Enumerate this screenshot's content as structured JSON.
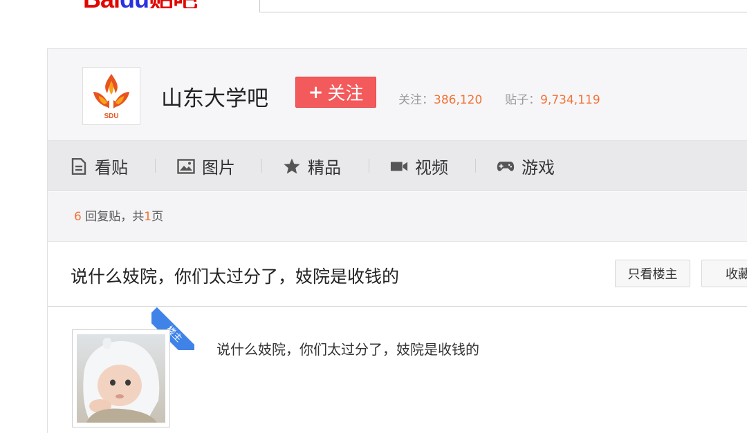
{
  "header": {
    "logo_text": "Bai",
    "logo_paw": "du",
    "logo_suffix": "贴吧"
  },
  "forum": {
    "name": "山东大学吧",
    "avatar_label": "SDU",
    "follow_label": "关注",
    "follow_plus": "+",
    "followers_label": "关注：",
    "followers_value": "386,120",
    "posts_label": "贴子：",
    "posts_value": "9,734,119"
  },
  "tabs": [
    {
      "label": "看贴",
      "icon": "document-icon"
    },
    {
      "label": "图片",
      "icon": "image-icon"
    },
    {
      "label": "精品",
      "icon": "star-icon"
    },
    {
      "label": "视频",
      "icon": "video-camera-icon"
    },
    {
      "label": "游戏",
      "icon": "gamepad-icon"
    }
  ],
  "reply_info": {
    "count": "6",
    "count_suffix": "回复贴，共",
    "pages": "1",
    "pages_suffix": "页"
  },
  "thread": {
    "title": "说什么妓院，你们太过分了，妓院是收钱的",
    "only_op_label": "只看楼主",
    "favorite_label": "收藏"
  },
  "post": {
    "badge": "楼主",
    "content": "说什么妓院，你们太过分了，妓院是收钱的"
  },
  "colors": {
    "accent_orange": "#f37235",
    "follow_red": "#f35a5c",
    "badge_blue": "#3f83e8"
  }
}
